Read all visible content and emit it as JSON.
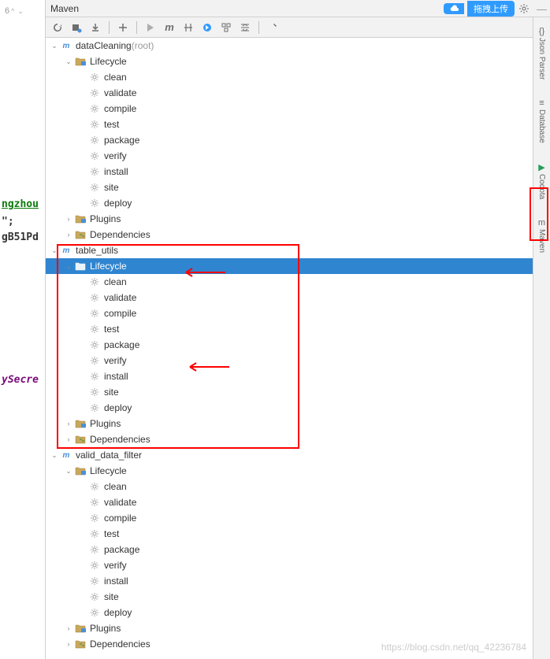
{
  "panel_title": "Maven",
  "top_buttons": {
    "upload": "拖拽上传"
  },
  "line_marker": "6",
  "code_fragments": {
    "f1": "ngzhou",
    "f2": "\";",
    "f3": "gB51Pd",
    "f4": "ySecre"
  },
  "projects": [
    {
      "name": "dataCleaning",
      "suffix": "(root)",
      "expanded": true,
      "lifecycle_expanded": true,
      "lifecycle": [
        "clean",
        "validate",
        "compile",
        "test",
        "package",
        "verify",
        "install",
        "site",
        "deploy"
      ],
      "plugins_label": "Plugins",
      "deps_label": "Dependencies"
    },
    {
      "name": "table_utils",
      "expanded": true,
      "lifecycle_expanded": true,
      "lifecycle_selected": true,
      "lifecycle": [
        "clean",
        "validate",
        "compile",
        "test",
        "package",
        "verify",
        "install",
        "site",
        "deploy"
      ],
      "plugins_label": "Plugins",
      "deps_label": "Dependencies"
    },
    {
      "name": "valid_data_filter",
      "expanded": true,
      "lifecycle_expanded": true,
      "lifecycle": [
        "clean",
        "validate",
        "compile",
        "test",
        "package",
        "verify",
        "install",
        "site",
        "deploy"
      ],
      "plugins_label": "Plugins",
      "deps_label": "Dependencies"
    }
  ],
  "lifecycle_label": "Lifecycle",
  "side_tabs": [
    {
      "label": "Json Parser",
      "icon": "{}"
    },
    {
      "label": "Database",
      "icon": "≡"
    },
    {
      "label": "Codota",
      "icon": "▶"
    },
    {
      "label": "Maven",
      "icon": "m"
    }
  ],
  "watermark": "https://blog.csdn.net/qq_42236784"
}
